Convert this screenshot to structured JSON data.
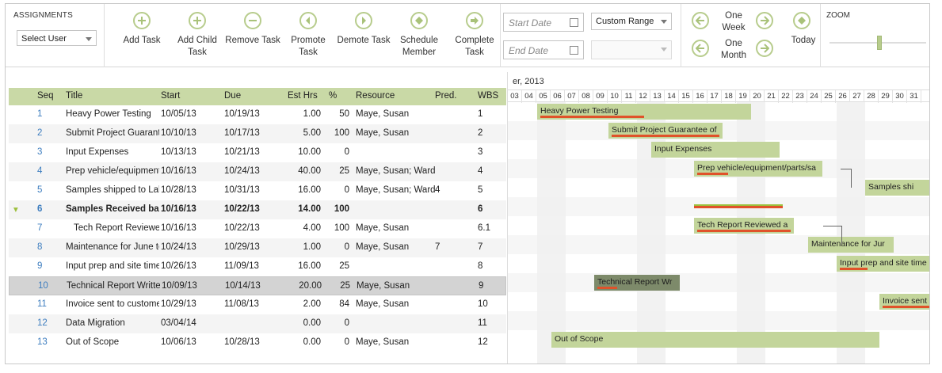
{
  "toolbar": {
    "assignments_label": "ASSIGNMENTS",
    "select_user": "Select User",
    "buttons": {
      "add_task": "Add Task",
      "add_child": "Add Child Task",
      "remove": "Remove Task",
      "promote": "Promote Task",
      "demote": "Demote Task",
      "schedule": "Schedule Member",
      "complete": "Complete Task"
    },
    "start_date_placeholder": "Start Date",
    "end_date_placeholder": "End Date",
    "range": "Custom Range",
    "one_week": "One Week",
    "one_month": "One Month",
    "today": "Today",
    "zoom_label": "ZOOM",
    "zoom_level": 0.5
  },
  "grid": {
    "headers": {
      "seq": "Seq",
      "title": "Title",
      "start": "Start",
      "due": "Due",
      "est": "Est Hrs",
      "pct": "%",
      "resource": "Resource",
      "pred": "Pred.",
      "wbs": "WBS"
    },
    "rows": [
      {
        "seq": "1",
        "title": "Heavy Power Testing",
        "start": "10/05/13",
        "due": "10/19/13",
        "est": "1.00",
        "pct": "50",
        "resource": "Maye, Susan",
        "pred": "",
        "wbs": "1"
      },
      {
        "seq": "2",
        "title": "Submit Project Guarantee",
        "start": "10/10/13",
        "due": "10/17/13",
        "est": "5.00",
        "pct": "100",
        "resource": "Maye, Susan",
        "pred": "",
        "wbs": "2"
      },
      {
        "seq": "3",
        "title": "Input Expenses",
        "start": "10/13/13",
        "due": "10/21/13",
        "est": "10.00",
        "pct": "0",
        "resource": "",
        "pred": "",
        "wbs": "3"
      },
      {
        "seq": "4",
        "title": "Prep vehicle/equipment",
        "start": "10/16/13",
        "due": "10/24/13",
        "est": "40.00",
        "pct": "25",
        "resource": "Maye, Susan; Ward,",
        "pred": "",
        "wbs": "4"
      },
      {
        "seq": "5",
        "title": "Samples shipped to Lab",
        "start": "10/28/13",
        "due": "10/31/13",
        "est": "16.00",
        "pct": "0",
        "resource": "Maye, Susan; Ward,",
        "pred": "4",
        "wbs": "5"
      },
      {
        "seq": "6",
        "title": "Samples Received bac",
        "start": "10/16/13",
        "due": "10/22/13",
        "est": "14.00",
        "pct": "100",
        "resource": "",
        "pred": "",
        "wbs": "6"
      },
      {
        "seq": "7",
        "title": "Tech Report Reviewed",
        "start": "10/16/13",
        "due": "10/22/13",
        "est": "4.00",
        "pct": "100",
        "resource": "Maye, Susan",
        "pred": "",
        "wbs": "6.1"
      },
      {
        "seq": "8",
        "title": "Maintenance for June to",
        "start": "10/24/13",
        "due": "10/29/13",
        "est": "1.00",
        "pct": "0",
        "resource": "Maye, Susan",
        "pred": "7",
        "wbs": "7"
      },
      {
        "seq": "9",
        "title": "Input prep and site time",
        "start": "10/26/13",
        "due": "11/09/13",
        "est": "16.00",
        "pct": "25",
        "resource": "",
        "pred": "",
        "wbs": "8"
      },
      {
        "seq": "10",
        "title": "Technical Report Writter",
        "start": "10/09/13",
        "due": "10/14/13",
        "est": "20.00",
        "pct": "25",
        "resource": "Maye, Susan",
        "pred": "",
        "wbs": "9"
      },
      {
        "seq": "11",
        "title": "Invoice sent to custome",
        "start": "10/29/13",
        "due": "11/08/13",
        "est": "2.00",
        "pct": "84",
        "resource": "Maye, Susan",
        "pred": "",
        "wbs": "10"
      },
      {
        "seq": "12",
        "title": "Data Migration",
        "start": "03/04/14",
        "due": "",
        "est": "0.00",
        "pct": "0",
        "resource": "",
        "pred": "",
        "wbs": "11"
      },
      {
        "seq": "13",
        "title": "Out of Scope",
        "start": "10/06/13",
        "due": "10/28/13",
        "est": "0.00",
        "pct": "0",
        "resource": "Maye, Susan",
        "pred": "",
        "wbs": "12"
      }
    ]
  },
  "gantt": {
    "month": "er, 2013",
    "days": [
      "03",
      "04",
      "05",
      "06",
      "07",
      "08",
      "09",
      "10",
      "11",
      "12",
      "13",
      "14",
      "15",
      "16",
      "17",
      "18",
      "19",
      "20",
      "21",
      "22",
      "23",
      "24",
      "25",
      "26",
      "27",
      "28",
      "29",
      "30",
      "31"
    ],
    "bars": [
      {
        "label": "Heavy Power Testing",
        "start": "05",
        "end": "19",
        "progress": 0.5
      },
      {
        "label": "Submit Project Guarantee of",
        "start": "10",
        "end": "17",
        "progress": 1.0
      },
      {
        "label": "Input Expenses",
        "start": "13",
        "end": "21",
        "progress": 0
      },
      {
        "label": "Prep vehicle/equipment/parts/sa",
        "start": "16",
        "end": "24",
        "progress": 0.25
      },
      {
        "label": "Samples shi",
        "start": "28",
        "end": "31",
        "progress": 0
      },
      {
        "label": "",
        "start": "16",
        "end": "22",
        "progress": 1.0
      },
      {
        "label": "Tech Report Reviewed a",
        "start": "16",
        "end": "22",
        "progress": 1.0
      },
      {
        "label": "Maintenance for Jur",
        "start": "24",
        "end": "29",
        "progress": 0
      },
      {
        "label": "Input prep and site time",
        "start": "26",
        "end": "31",
        "progress": 0.25
      },
      {
        "label": "Technical Report Wr",
        "start": "09",
        "end": "14",
        "progress": 0.25
      },
      {
        "label": "Invoice sent to",
        "start": "29",
        "end": "31",
        "progress": 0.84
      },
      {
        "label": "",
        "start": "",
        "end": "",
        "progress": 0
      },
      {
        "label": "Out of Scope",
        "start": "06",
        "end": "28",
        "progress": 0
      }
    ]
  },
  "colors": {
    "accent": "#c9d9a6",
    "bar": "#c3d59b",
    "progress": "#e0522a",
    "link": "#3d7dbf"
  }
}
